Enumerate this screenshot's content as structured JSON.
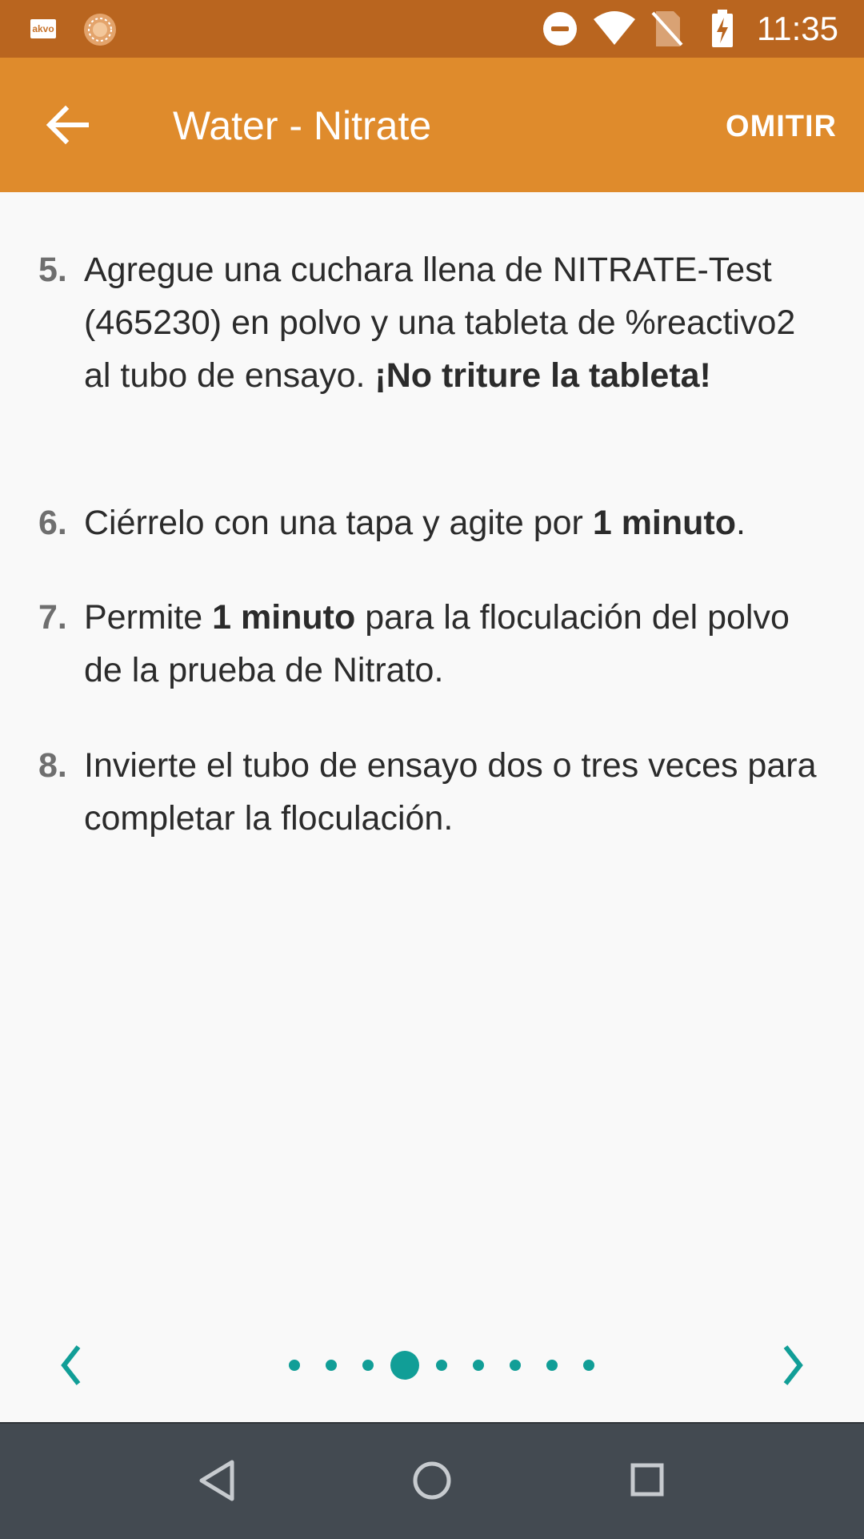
{
  "status_bar": {
    "time": "11:35",
    "app_icon_label": "akvo",
    "icons": [
      "akvo-app-icon",
      "sun-icon",
      "do-not-disturb-icon",
      "wifi-icon",
      "no-sim-icon",
      "battery-charging-icon"
    ]
  },
  "app_bar": {
    "title": "Water - Nitrate",
    "skip_label": "OMITIR",
    "back_icon": "arrow-back-icon"
  },
  "steps": [
    {
      "number": "5.",
      "parts": [
        {
          "text": "Agregue una cuchara llena de NITRATE-Test (465230) en polvo y una tableta de %reactivo2 al tubo de ensayo. ",
          "bold": false
        },
        {
          "text": "¡No triture la tableta!",
          "bold": true
        }
      ]
    },
    {
      "number": "6.",
      "parts": [
        {
          "text": "Ciérrelo con una tapa y agite por ",
          "bold": false
        },
        {
          "text": "1 minuto",
          "bold": true
        },
        {
          "text": ".",
          "bold": false
        }
      ]
    },
    {
      "number": "7.",
      "parts": [
        {
          "text": "Permite ",
          "bold": false
        },
        {
          "text": "1 minuto",
          "bold": true
        },
        {
          "text": " para la floculación del polvo de la prueba de Nitrato.",
          "bold": false
        }
      ]
    },
    {
      "number": "8.",
      "parts": [
        {
          "text": "Invierte el tubo de ensayo dos o tres veces para completar la floculación.",
          "bold": false
        }
      ]
    }
  ],
  "pager": {
    "page_count": 9,
    "current_page": 4,
    "prev_icon": "chevron-left-icon",
    "next_icon": "chevron-right-icon",
    "accent_color": "#119e97"
  },
  "nav_bar": {
    "buttons": [
      "back-triangle-icon",
      "home-circle-icon",
      "recents-square-icon"
    ]
  },
  "colors": {
    "status_bar": "#b9651f",
    "app_bar": "#df8b2c",
    "background": "#f9f9f9",
    "nav_bar": "#434a51"
  }
}
